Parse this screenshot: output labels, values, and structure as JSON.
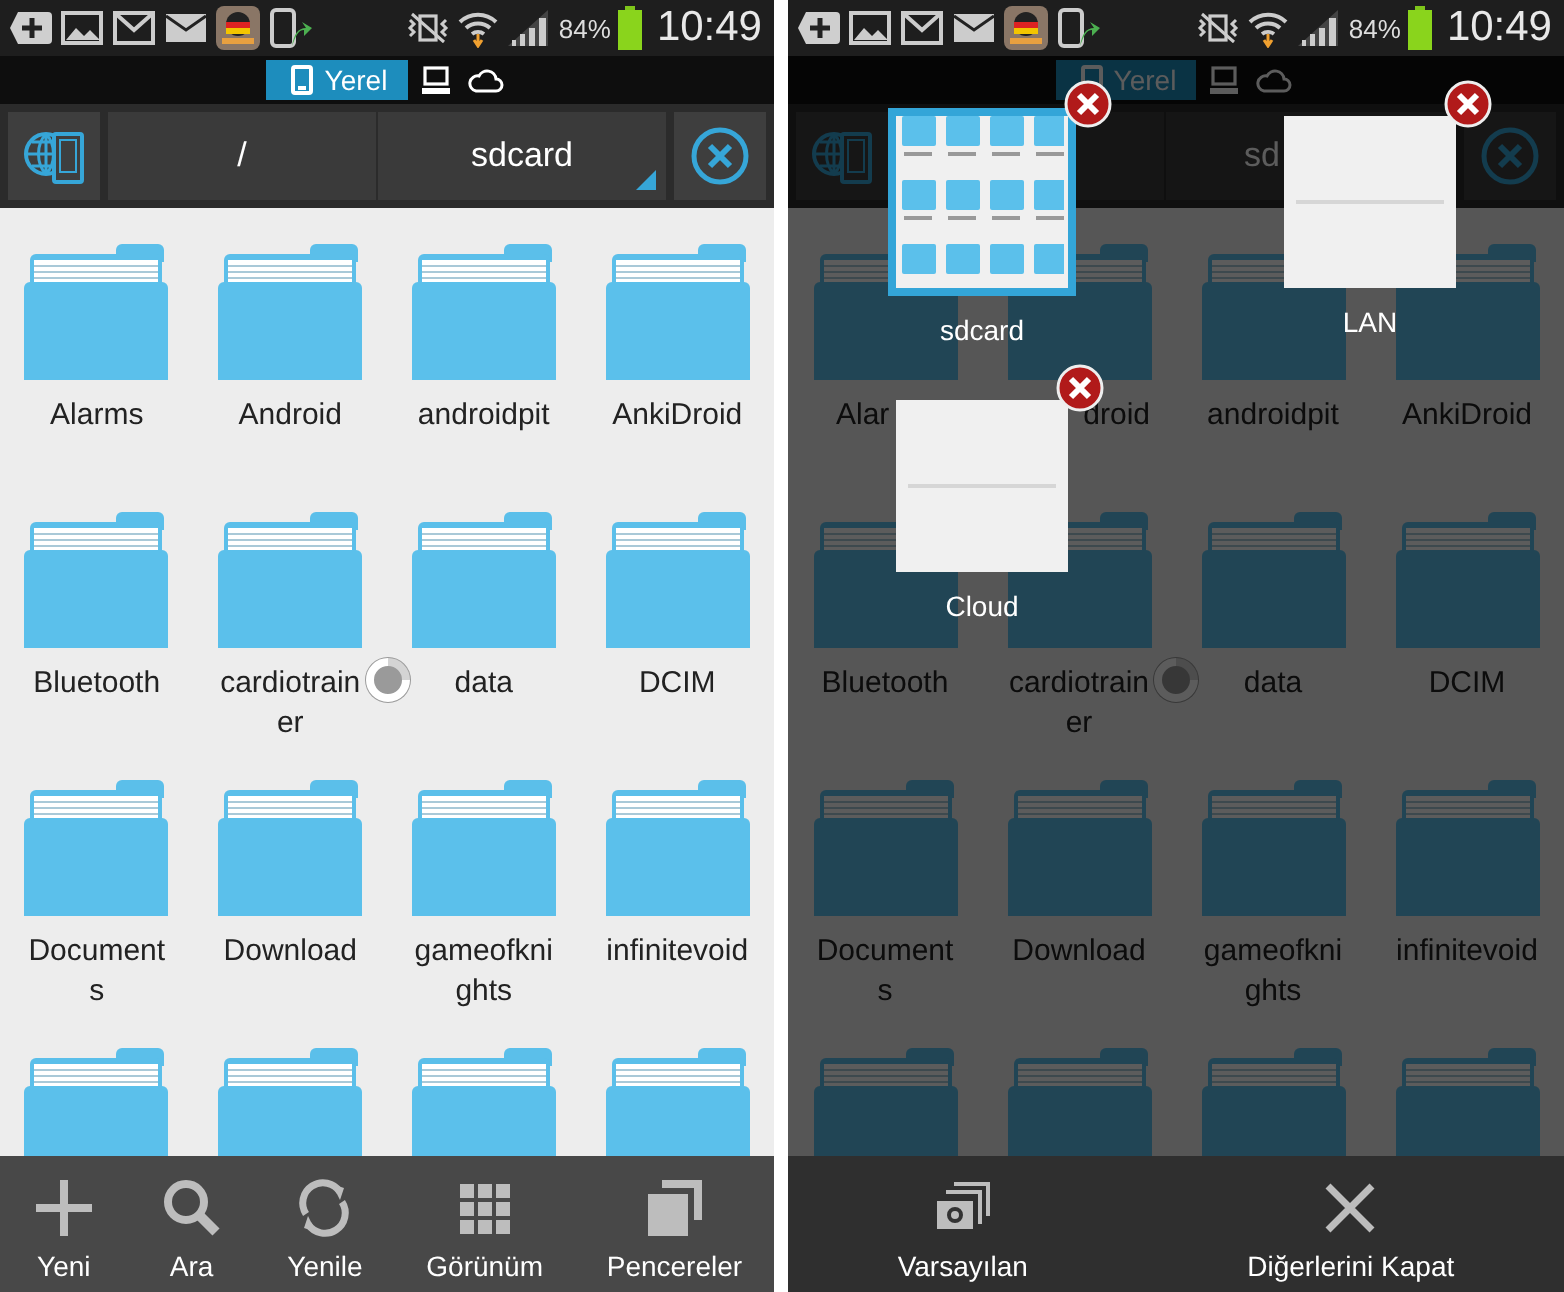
{
  "panels": [
    {
      "status_bar": {
        "battery": "84%",
        "time": "10:49"
      },
      "location_tabs": [
        {
          "kind": "device",
          "label": "Yerel",
          "selected": true
        },
        {
          "kind": "lan",
          "selected": false
        },
        {
          "kind": "cloud",
          "selected": false
        }
      ],
      "path_bar": {
        "parent": "/",
        "current": "sdcard"
      },
      "folders": [
        {
          "kind": "folder",
          "label": "Alarms"
        },
        {
          "kind": "folder",
          "label": "Android"
        },
        {
          "kind": "folder",
          "label": "androidpit"
        },
        {
          "kind": "folder",
          "label": "AnkiDroid"
        },
        {
          "kind": "folder",
          "label": "Bluetooth"
        },
        {
          "kind": "folder",
          "label": "cardiotrainer"
        },
        {
          "kind": "folder",
          "label": "data"
        },
        {
          "kind": "folder",
          "label": "DCIM"
        },
        {
          "kind": "folder",
          "label": "Documents"
        },
        {
          "kind": "folder",
          "label": "Download"
        },
        {
          "kind": "folder",
          "label": "gameofknights"
        },
        {
          "kind": "folder",
          "label": "infinitevoid"
        },
        {
          "kind": "folder"
        },
        {
          "kind": "folder"
        },
        {
          "kind": "folder"
        },
        {
          "kind": "folder"
        }
      ],
      "toolbar": [
        {
          "kind": "new",
          "label": "Yeni"
        },
        {
          "kind": "search",
          "label": "Ara"
        },
        {
          "kind": "refresh",
          "label": "Yenile"
        },
        {
          "kind": "grid",
          "label": "Görünüm"
        },
        {
          "kind": "windows",
          "label": "Pencereler"
        }
      ]
    },
    {
      "status_bar": {
        "battery": "84%",
        "time": "10:49"
      },
      "location_tabs": [
        {
          "kind": "device",
          "label": "Yerel",
          "selected": true
        },
        {
          "kind": "lan",
          "selected": false
        },
        {
          "kind": "cloud",
          "selected": false
        }
      ],
      "path_bar": {
        "current": "sd"
      },
      "folders": [
        {
          "kind": "folder_tail_hidden",
          "label": "Alar"
        },
        {
          "kind": "folder_head_hidden",
          "label": "droid"
        },
        {
          "kind": "folder",
          "label": "androidpit"
        },
        {
          "kind": "folder",
          "label": "AnkiDroid"
        },
        {
          "kind": "folder",
          "label": "Bluetooth"
        },
        {
          "kind": "folder",
          "label": "cardiotrainer"
        },
        {
          "kind": "folder",
          "label": "data"
        },
        {
          "kind": "folder",
          "label": "DCIM"
        },
        {
          "kind": "folder",
          "label": "Documents"
        },
        {
          "kind": "folder",
          "label": "Download"
        },
        {
          "kind": "folder",
          "label": "gameofknights"
        },
        {
          "kind": "folder",
          "label": "infinitevoid"
        },
        {
          "kind": "folder"
        },
        {
          "kind": "folder"
        },
        {
          "kind": "folder"
        },
        {
          "kind": "folder"
        }
      ],
      "windows": [
        {
          "kind": "files",
          "label": "sdcard",
          "selected": true
        },
        {
          "kind": "blank",
          "label": "LAN",
          "selected": false
        },
        {
          "kind": "blank",
          "label": "Cloud",
          "selected": false
        }
      ],
      "toolbar": [
        {
          "kind": "default",
          "label": "Varsayılan"
        },
        {
          "kind": "close",
          "label": "Diğerlerini Kapat"
        }
      ]
    }
  ]
}
